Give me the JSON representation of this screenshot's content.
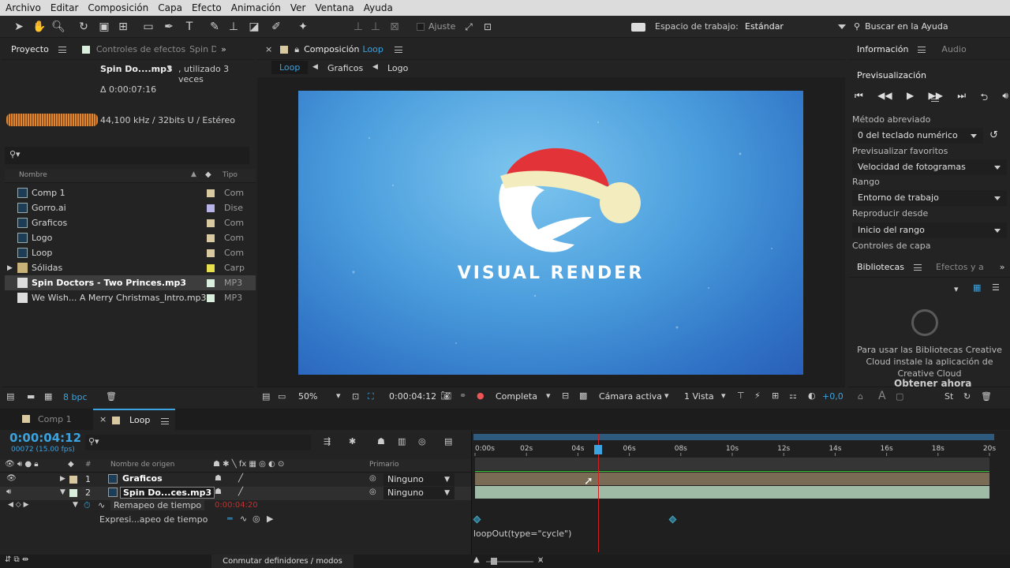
{
  "menubar": [
    "Archivo",
    "Editar",
    "Composición",
    "Capa",
    "Efecto",
    "Animación",
    "Ver",
    "Ventana",
    "Ayuda"
  ],
  "toolbar": {
    "snap_label": "Ajuste",
    "workspace_label": "Espacio de trabajo:",
    "workspace_value": "Estándar",
    "search_help": "Buscar en la Ayuda"
  },
  "project": {
    "tab": "Proyecto",
    "effects_tab": "Controles de efectos",
    "effects_target": "Spin Do",
    "file_name": "Spin Do....mp3",
    "usage": ", utilizado 3 veces",
    "duration": "Δ 0:00:07:16",
    "audio_info": "44,100 kHz / 32bits U / Estéreo",
    "col_name": "Nombre",
    "col_type": "Tipo",
    "items": [
      {
        "name": "Comp 1",
        "type": "Com",
        "color": "#d8c9a0"
      },
      {
        "name": "Gorro.ai",
        "type": "Dise",
        "color": "#b7b3e6"
      },
      {
        "name": "Graficos",
        "type": "Com",
        "color": "#d8c9a0"
      },
      {
        "name": "Logo",
        "type": "Com",
        "color": "#d8c9a0"
      },
      {
        "name": "Loop",
        "type": "Com",
        "color": "#d8c9a0"
      },
      {
        "name": "Sólidas",
        "type": "Carp",
        "color": "#e8e04a"
      },
      {
        "name": "Spin Doctors - Two Princes.mp3",
        "type": "MP3",
        "color": "#d9eedd"
      },
      {
        "name": "We Wish... A Merry Christmas_Intro.mp3",
        "type": "MP3",
        "color": "#d9eedd"
      }
    ],
    "bpc": "8 bpc"
  },
  "comp": {
    "tab_prefix": "Composición",
    "tab_name": "Loop",
    "crumbs": [
      "Loop",
      "Graficos",
      "Logo"
    ],
    "logo_text": "VISUAL RENDER",
    "zoom": "50%",
    "time": "0:00:04:12",
    "quality": "Completa",
    "camera": "Cámara activa",
    "views": "1 Vista",
    "exposure": "+0,0"
  },
  "info": {
    "tab_info": "Información",
    "tab_audio": "Audio",
    "preview_title": "Previsualización",
    "method_label": "Método abreviado",
    "method_value": "0 del teclado numérico",
    "fav_label": "Previsualizar favoritos",
    "fav_value": "Velocidad de fotogramas",
    "range_label": "Rango",
    "range_value": "Entorno de trabajo",
    "play_label": "Reproducir desde",
    "play_value": "Inicio del rango",
    "layer_controls": "Controles de capa"
  },
  "libraries": {
    "tab": "Bibliotecas",
    "tab2": "Efectos y a",
    "message": "Para usar las Bibliotecas Creative Cloud instale la aplicación de Creative Cloud",
    "cta": "Obtener ahora"
  },
  "timeline": {
    "tab_comp1": "Comp 1",
    "tab_loop": "Loop",
    "timecode": "0:00:04:12",
    "frames": "00072 (15.00 fps)",
    "col_source": "Nombre de origen",
    "col_parent": "Primario",
    "layers": [
      {
        "num": "1",
        "name": "Graficos",
        "parent": "Ninguno"
      },
      {
        "num": "2",
        "name": "Spin Do...ces.mp3",
        "parent": "Ninguno"
      }
    ],
    "prop_name": "Remapeo de tiempo",
    "prop_value": "0:00:04:20",
    "expr_name": "Expresi...apeo de tiempo",
    "expr_text": "loopOut(type=\"cycle\")",
    "ruler": [
      "0:00s",
      "02s",
      "04s",
      "06s",
      "08s",
      "10s",
      "12s",
      "14s",
      "16s",
      "18s",
      "20s"
    ],
    "toggle": "Conmutar definidores / modos",
    "playhead_s": 4.8,
    "duration_s": 20
  }
}
